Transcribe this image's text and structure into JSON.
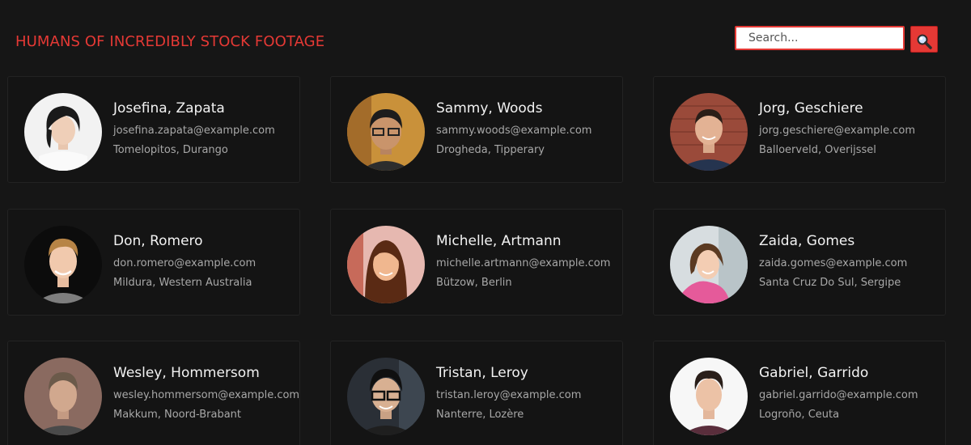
{
  "header": {
    "title": "HUMANS OF INCREDIBLY STOCK FOOTAGE",
    "accent_color": "#e53935"
  },
  "search": {
    "placeholder": "Search...",
    "value": "",
    "button_icon": "magnifier-icon"
  },
  "people": [
    {
      "name": "Josefina, Zapata",
      "email": "josefina.zapata@example.com",
      "location": "Tomelopitos, Durango"
    },
    {
      "name": "Sammy, Woods",
      "email": "sammy.woods@example.com",
      "location": "Drogheda, Tipperary"
    },
    {
      "name": "Jorg, Geschiere",
      "email": "jorg.geschiere@example.com",
      "location": "Balloerveld, Overijssel"
    },
    {
      "name": "Don, Romero",
      "email": "don.romero@example.com",
      "location": "Mildura, Western Australia"
    },
    {
      "name": "Michelle, Artmann",
      "email": "michelle.artmann@example.com",
      "location": "Bützow, Berlin"
    },
    {
      "name": "Zaida, Gomes",
      "email": "zaida.gomes@example.com",
      "location": "Santa Cruz Do Sul, Sergipe"
    },
    {
      "name": "Wesley, Hommersom",
      "email": "wesley.hommersom@example.com",
      "location": "Makkum, Noord-Brabant"
    },
    {
      "name": "Tristan, Leroy",
      "email": "tristan.leroy@example.com",
      "location": "Nanterre, Lozère"
    },
    {
      "name": "Gabriel, Garrido",
      "email": "gabriel.garrido@example.com",
      "location": "Logroño, Ceuta"
    }
  ]
}
